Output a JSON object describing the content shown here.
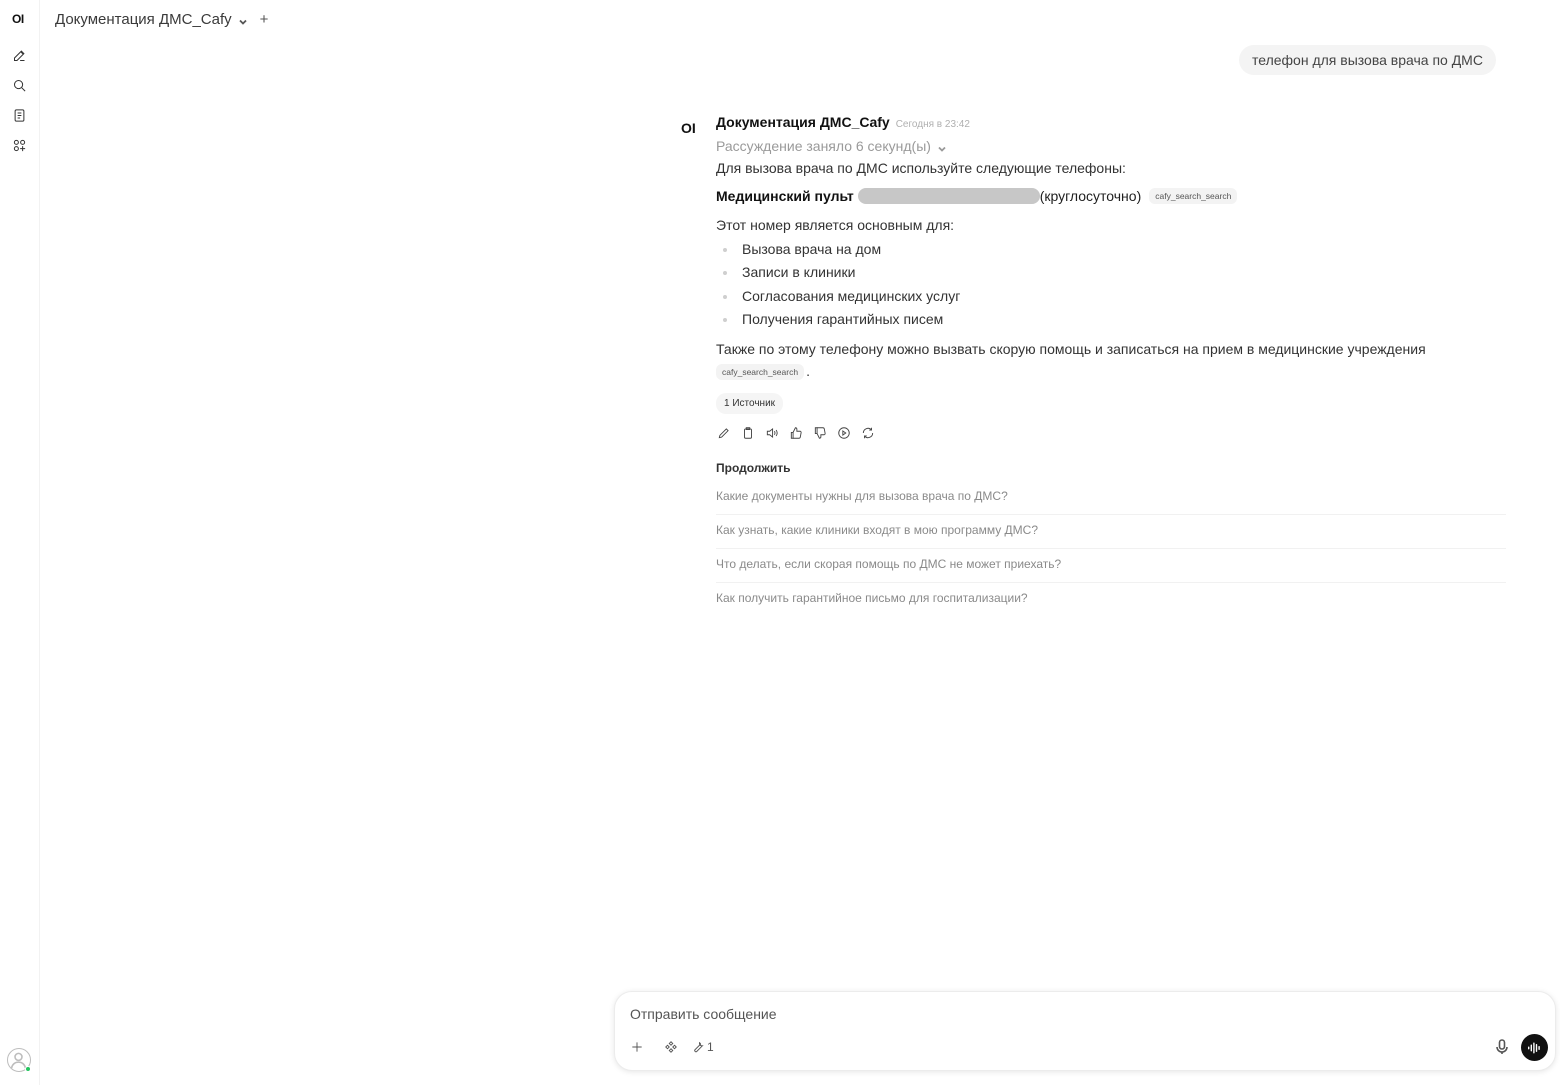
{
  "sidebar": {
    "logo": "OI",
    "icons": [
      "new-chat-icon",
      "search-icon",
      "notes-icon",
      "workspace-icon"
    ]
  },
  "header": {
    "model_name": "Документация ДМС_Cafy",
    "add_label": "+"
  },
  "user_message": "телефон для вызова врача по ДМС",
  "assistant": {
    "logo": "OI",
    "name": "Документация ДМС_Cafy",
    "time": "Сегодня в 23:42",
    "reasoning": "Рассуждение заняло 6 секунд(ы)",
    "intro": "Для вызова врача по ДМС используйте следующие телефоны:",
    "phone_label": "Медицинский пульт",
    "phone_suffix": "(круглосуточно)",
    "citation_1": "cafy_search_search",
    "used_for": "Этот номер является основным для:",
    "list": [
      "Вызова врача на дом",
      "Записи в клиники",
      "Согласования медицинских услуг",
      "Получения гарантийных писем"
    ],
    "also": "Также по этому телефону можно вызвать скорую помощь и записаться на прием в медицинские учреждения",
    "citation_2": "cafy_search_search",
    "period": ".",
    "sources": "1 Источник",
    "continue_label": "Продолжить",
    "suggestions": [
      "Какие документы нужны для вызова врача по ДМС?",
      "Как узнать, какие клиники входят в мою программу ДМС?",
      "Что делать, если скорая помощь по ДМС не может приехать?",
      "Как получить гарантийное письмо для госпитализации?"
    ]
  },
  "composer": {
    "placeholder": "Отправить сообщение",
    "tool_count": "1"
  },
  "colors": {
    "accent": "#111111",
    "online": "#22c55e"
  }
}
